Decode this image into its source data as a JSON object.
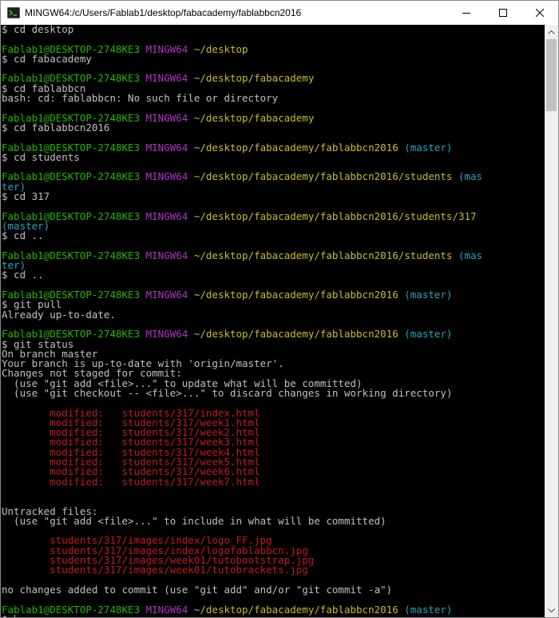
{
  "window": {
    "title": "MINGW64:/c/Users/Fablab1/desktop/fabacademy/fablabbcn2016",
    "icon": "mingw-terminal-icon"
  },
  "colors": {
    "background": "#000000",
    "text": "#c0c0c0",
    "user_host": "#23b800",
    "shell_name": "#b233c6",
    "path": "#c5bf2a",
    "branch": "#26a5c2",
    "modified": "#c51a1a"
  },
  "terminal": {
    "lines": [
      [
        {
          "t": "$ cd desktop",
          "c": ""
        }
      ],
      [],
      [
        {
          "t": "Fablab1@DESKTOP-2748KE3",
          "c": "green"
        },
        {
          "t": " ",
          "c": ""
        },
        {
          "t": "MINGW64",
          "c": "magenta"
        },
        {
          "t": " ",
          "c": ""
        },
        {
          "t": "~/desktop",
          "c": "yellow"
        }
      ],
      [
        {
          "t": "$ cd fabacademy",
          "c": ""
        }
      ],
      [],
      [
        {
          "t": "Fablab1@DESKTOP-2748KE3",
          "c": "green"
        },
        {
          "t": " ",
          "c": ""
        },
        {
          "t": "MINGW64",
          "c": "magenta"
        },
        {
          "t": " ",
          "c": ""
        },
        {
          "t": "~/desktop/fabacademy",
          "c": "yellow"
        }
      ],
      [
        {
          "t": "$ cd fablabbcn",
          "c": ""
        }
      ],
      [
        {
          "t": "bash: cd: fablabbcn: No such file or directory",
          "c": ""
        }
      ],
      [],
      [
        {
          "t": "Fablab1@DESKTOP-2748KE3",
          "c": "green"
        },
        {
          "t": " ",
          "c": ""
        },
        {
          "t": "MINGW64",
          "c": "magenta"
        },
        {
          "t": " ",
          "c": ""
        },
        {
          "t": "~/desktop/fabacademy",
          "c": "yellow"
        }
      ],
      [
        {
          "t": "$ cd fablabbcn2016",
          "c": ""
        }
      ],
      [],
      [
        {
          "t": "Fablab1@DESKTOP-2748KE3",
          "c": "green"
        },
        {
          "t": " ",
          "c": ""
        },
        {
          "t": "MINGW64",
          "c": "magenta"
        },
        {
          "t": " ",
          "c": ""
        },
        {
          "t": "~/desktop/fabacademy/fablabbcn2016",
          "c": "yellow"
        },
        {
          "t": " ",
          "c": ""
        },
        {
          "t": "(master)",
          "c": "cyan"
        }
      ],
      [
        {
          "t": "$ cd students",
          "c": ""
        }
      ],
      [],
      [
        {
          "t": "Fablab1@DESKTOP-2748KE3",
          "c": "green"
        },
        {
          "t": " ",
          "c": ""
        },
        {
          "t": "MINGW64",
          "c": "magenta"
        },
        {
          "t": " ",
          "c": ""
        },
        {
          "t": "~/desktop/fabacademy/fablabbcn2016/students",
          "c": "yellow"
        },
        {
          "t": " ",
          "c": ""
        },
        {
          "t": "(mas",
          "c": "cyan"
        }
      ],
      [
        {
          "t": "ter)",
          "c": "cyan"
        }
      ],
      [
        {
          "t": "$ cd 317",
          "c": ""
        }
      ],
      [],
      [
        {
          "t": "Fablab1@DESKTOP-2748KE3",
          "c": "green"
        },
        {
          "t": " ",
          "c": ""
        },
        {
          "t": "MINGW64",
          "c": "magenta"
        },
        {
          "t": " ",
          "c": ""
        },
        {
          "t": "~/desktop/fabacademy/fablabbcn2016/students/317",
          "c": "yellow"
        }
      ],
      [
        {
          "t": "(master)",
          "c": "cyan"
        }
      ],
      [
        {
          "t": "$ cd ..",
          "c": ""
        }
      ],
      [],
      [
        {
          "t": "Fablab1@DESKTOP-2748KE3",
          "c": "green"
        },
        {
          "t": " ",
          "c": ""
        },
        {
          "t": "MINGW64",
          "c": "magenta"
        },
        {
          "t": " ",
          "c": ""
        },
        {
          "t": "~/desktop/fabacademy/fablabbcn2016/students",
          "c": "yellow"
        },
        {
          "t": " ",
          "c": ""
        },
        {
          "t": "(mas",
          "c": "cyan"
        }
      ],
      [
        {
          "t": "ter)",
          "c": "cyan"
        }
      ],
      [
        {
          "t": "$ cd ..",
          "c": ""
        }
      ],
      [],
      [
        {
          "t": "Fablab1@DESKTOP-2748KE3",
          "c": "green"
        },
        {
          "t": " ",
          "c": ""
        },
        {
          "t": "MINGW64",
          "c": "magenta"
        },
        {
          "t": " ",
          "c": ""
        },
        {
          "t": "~/desktop/fabacademy/fablabbcn2016",
          "c": "yellow"
        },
        {
          "t": " ",
          "c": ""
        },
        {
          "t": "(master)",
          "c": "cyan"
        }
      ],
      [
        {
          "t": "$ git pull",
          "c": ""
        }
      ],
      [
        {
          "t": "Already up-to-date.",
          "c": ""
        }
      ],
      [],
      [
        {
          "t": "Fablab1@DESKTOP-2748KE3",
          "c": "green"
        },
        {
          "t": " ",
          "c": ""
        },
        {
          "t": "MINGW64",
          "c": "magenta"
        },
        {
          "t": " ",
          "c": ""
        },
        {
          "t": "~/desktop/fabacademy/fablabbcn2016",
          "c": "yellow"
        },
        {
          "t": " ",
          "c": ""
        },
        {
          "t": "(master)",
          "c": "cyan"
        }
      ],
      [
        {
          "t": "$ git status",
          "c": ""
        }
      ],
      [
        {
          "t": "On branch master",
          "c": ""
        }
      ],
      [
        {
          "t": "Your branch is up-to-date with 'origin/master'.",
          "c": ""
        }
      ],
      [
        {
          "t": "Changes not staged for commit:",
          "c": ""
        }
      ],
      [
        {
          "t": "  (use \"git add <file>...\" to update what will be committed)",
          "c": ""
        }
      ],
      [
        {
          "t": "  (use \"git checkout -- <file>...\" to discard changes in working directory)",
          "c": ""
        }
      ],
      [],
      [
        {
          "t": "        modified:   students/317/index.html",
          "c": "red"
        }
      ],
      [
        {
          "t": "        modified:   students/317/week1.html",
          "c": "red"
        }
      ],
      [
        {
          "t": "        modified:   students/317/week2.html",
          "c": "red"
        }
      ],
      [
        {
          "t": "        modified:   students/317/week3.html",
          "c": "red"
        }
      ],
      [
        {
          "t": "        modified:   students/317/week4.html",
          "c": "red"
        }
      ],
      [
        {
          "t": "        modified:   students/317/week5.html",
          "c": "red"
        }
      ],
      [
        {
          "t": "        modified:   students/317/week6.html",
          "c": "red"
        }
      ],
      [
        {
          "t": "        modified:   students/317/week7.html",
          "c": "red"
        }
      ],
      [],
      [],
      [
        {
          "t": "Untracked files:",
          "c": ""
        }
      ],
      [
        {
          "t": "  (use \"git add <file>...\" to include in what will be committed)",
          "c": ""
        }
      ],
      [],
      [
        {
          "t": "        students/317/images/index/logo_FF.jpg",
          "c": "red"
        }
      ],
      [
        {
          "t": "        students/317/images/index/logofablabbcn.jpg",
          "c": "red"
        }
      ],
      [
        {
          "t": "        students/317/images/week01/tutobootstrap.jpg",
          "c": "red"
        }
      ],
      [
        {
          "t": "        students/317/images/week01/tutobrackets.jpg",
          "c": "red"
        }
      ],
      [],
      [
        {
          "t": "no changes added to commit (use \"git add\" and/or \"git commit -a\")",
          "c": ""
        }
      ],
      [],
      [
        {
          "t": "Fablab1@DESKTOP-2748KE3",
          "c": "green"
        },
        {
          "t": " ",
          "c": ""
        },
        {
          "t": "MINGW64",
          "c": "magenta"
        },
        {
          "t": " ",
          "c": ""
        },
        {
          "t": "~/desktop/fabacademy/fablabbcn2016",
          "c": "yellow"
        },
        {
          "t": " ",
          "c": ""
        },
        {
          "t": "(master)",
          "c": "cyan"
        }
      ],
      [
        {
          "t": "$ ",
          "c": "",
          "cursor": true
        }
      ]
    ]
  }
}
